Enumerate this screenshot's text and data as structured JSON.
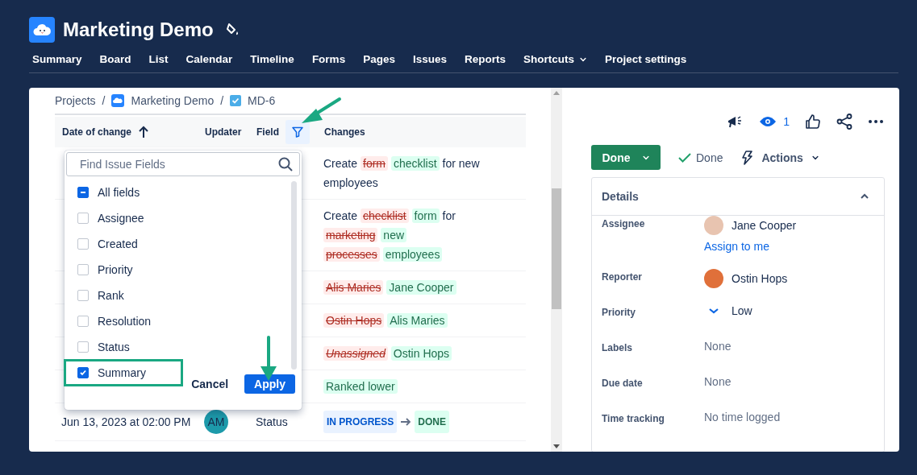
{
  "project": {
    "title": "Marketing Demo"
  },
  "nav": [
    {
      "label": "Summary",
      "dropdown": false
    },
    {
      "label": "Board",
      "dropdown": false
    },
    {
      "label": "List",
      "dropdown": false
    },
    {
      "label": "Calendar",
      "dropdown": false
    },
    {
      "label": "Timeline",
      "dropdown": false
    },
    {
      "label": "Forms",
      "dropdown": false
    },
    {
      "label": "Pages",
      "dropdown": false
    },
    {
      "label": "Issues",
      "dropdown": false
    },
    {
      "label": "Reports",
      "dropdown": false
    },
    {
      "label": "Shortcuts",
      "dropdown": true
    },
    {
      "label": "Project settings",
      "dropdown": false
    }
  ],
  "breadcrumbs": [
    {
      "label": "Projects",
      "kind": "plain"
    },
    {
      "label": "Marketing Demo",
      "kind": "project"
    },
    {
      "label": "MD-6",
      "kind": "task"
    }
  ],
  "separator": "/",
  "history": {
    "columns": [
      {
        "label": "Date of change",
        "kind": "sort"
      },
      {
        "label": "Updater",
        "kind": "plain"
      },
      {
        "label": "Field",
        "kind": "filter"
      },
      {
        "label": "Changes",
        "kind": "plain"
      }
    ],
    "rows": [
      {
        "changes": [
          {
            "kind": "text",
            "text": "Create"
          },
          {
            "kind": "diff",
            "removed": "form",
            "added": "checklist",
            "removed_unset": false
          },
          {
            "kind": "text",
            "text": "for new employees"
          }
        ]
      },
      {
        "changes": [
          {
            "kind": "text",
            "text": "Create"
          },
          {
            "kind": "diff",
            "removed": "checklist",
            "added": "form",
            "removed_unset": false
          },
          {
            "kind": "text",
            "text": "for"
          },
          {
            "kind": "diff",
            "removed": "marketing",
            "added": "new",
            "removed_unset": false
          },
          {
            "kind": "diff",
            "removed": "processes",
            "added": "employees",
            "removed_unset": false
          }
        ]
      },
      {
        "changes": [
          {
            "kind": "diff",
            "removed": "Alis Maries",
            "added": "Jane Cooper",
            "removed_unset": false
          }
        ]
      },
      {
        "changes": [
          {
            "kind": "diff",
            "removed": "Ostin Hops",
            "added": "Alis Maries",
            "removed_unset": false
          }
        ]
      },
      {
        "changes": [
          {
            "kind": "diff",
            "removed": "Unassigned",
            "added": "Ostin Hops",
            "removed_unset": true
          }
        ]
      },
      {
        "changes": [
          {
            "kind": "note",
            "text": "Ranked lower"
          }
        ]
      },
      {
        "date": "Jun 13, 2023 at 02:00 PM",
        "updater": "AM",
        "field": "Status",
        "changes": [
          {
            "kind": "status",
            "from": "IN PROGRESS",
            "to": "DONE"
          }
        ]
      }
    ]
  },
  "field_filter": {
    "open": true,
    "placeholder": "Find Issue Fields",
    "options": [
      {
        "label": "All fields",
        "checked": false,
        "indeterminate": true
      },
      {
        "label": "Assignee",
        "checked": false,
        "indeterminate": false
      },
      {
        "label": "Created",
        "checked": false,
        "indeterminate": false
      },
      {
        "label": "Priority",
        "checked": false,
        "indeterminate": false
      },
      {
        "label": "Rank",
        "checked": false,
        "indeterminate": false
      },
      {
        "label": "Resolution",
        "checked": false,
        "indeterminate": false
      },
      {
        "label": "Status",
        "checked": false,
        "indeterminate": false
      },
      {
        "label": "Summary",
        "checked": true,
        "indeterminate": false
      }
    ],
    "cancel": "Cancel",
    "apply": "Apply"
  },
  "issue": {
    "watchers": "1",
    "status": "Done",
    "resolution": "Done",
    "actions": "Actions",
    "details": {
      "title": "Details",
      "expanded": true,
      "fields": [
        {
          "label": "Assignee",
          "kind": "person",
          "value": "Jane Cooper",
          "link": "Assign to me"
        },
        {
          "label": "Reporter",
          "kind": "person",
          "value": "Ostin Hops"
        },
        {
          "label": "Priority",
          "kind": "priority",
          "value": "Low"
        },
        {
          "label": "Labels",
          "kind": "empty",
          "value": "None"
        },
        {
          "label": "Due date",
          "kind": "empty",
          "value": "None"
        },
        {
          "label": "Time tracking",
          "kind": "empty",
          "value": "No time logged"
        }
      ]
    }
  }
}
